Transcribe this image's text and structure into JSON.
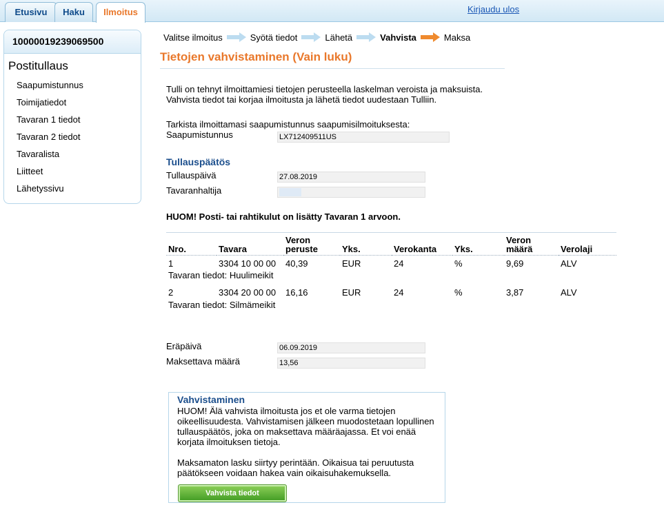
{
  "tabs": [
    {
      "label": "Etusivu"
    },
    {
      "label": "Haku"
    },
    {
      "label": "Ilmoitus"
    }
  ],
  "logout_label": "Kirjaudu ulos",
  "sidebar": {
    "id_number": "10000019239069500",
    "title": "Postitullaus",
    "items": [
      {
        "label": "Saapumistunnus"
      },
      {
        "label": "Toimijatiedot"
      },
      {
        "label": "Tavaran 1 tiedot"
      },
      {
        "label": "Tavaran 2 tiedot"
      },
      {
        "label": "Tavaralista"
      },
      {
        "label": "Liitteet"
      },
      {
        "label": "Lähetyssivu"
      }
    ]
  },
  "steps": [
    {
      "label": "Valitse ilmoitus"
    },
    {
      "label": "Syötä tiedot"
    },
    {
      "label": "Lähetä"
    },
    {
      "label": "Vahvista"
    },
    {
      "label": "Maksa"
    }
  ],
  "page_title": "Tietojen vahvistaminen  (Vain luku)",
  "intro": {
    "line1": "Tulli on tehnyt ilmoittamiesi tietojen perusteella laskelman veroista ja maksuista.",
    "line2": "Vahvista tiedot tai korjaa ilmoitusta ja lähetä tiedot uudestaan Tulliin."
  },
  "check_text": "Tarkista ilmoittamasi saapumistunnus saapumisilmoituksesta:",
  "arrival": {
    "label": "Saapumistunnus",
    "value": "LX712409511US"
  },
  "decision": {
    "title": "Tullauspäätös",
    "date_label": "Tullauspäivä",
    "date_value": "27.08.2019",
    "holder_label": "Tavaranhaltija",
    "holder_value": ""
  },
  "note": "HUOM! Posti- tai rahtikulut on lisätty Tavaran 1 arvoon.",
  "table": {
    "headers": {
      "nro": "Nro.",
      "tavara": "Tavara",
      "peruste_l1": "Veron",
      "peruste_l2": "peruste",
      "yks1": "Yks.",
      "verokanta": "Verokanta",
      "yks2": "Yks.",
      "maara_l1": "Veron",
      "maara_l2": "määrä",
      "verolaji": "Verolaji"
    },
    "rows": [
      {
        "nro": "1",
        "tavara": "3304 10 00 00",
        "peruste": "40,39",
        "yks1": "EUR",
        "verokanta": "24",
        "yks2": "%",
        "maara": "9,69",
        "verolaji": "ALV",
        "info": "Tavaran tiedot: Huulimeikit"
      },
      {
        "nro": "2",
        "tavara": "3304 20 00 00",
        "peruste": "16,16",
        "yks1": "EUR",
        "verokanta": "24",
        "yks2": "%",
        "maara": "3,87",
        "verolaji": "ALV",
        "info": "Tavaran tiedot: Silmämeikit"
      }
    ]
  },
  "due": {
    "label": "Eräpäivä",
    "value": "06.09.2019"
  },
  "amount": {
    "label": "Maksettava määrä",
    "value": "13,56"
  },
  "confirm": {
    "title": "Vahvistaminen",
    "p1_l1": "HUOM! Älä vahvista ilmoitusta jos et ole varma tietojen",
    "p1_l2": "oikeellisuudesta. Vahvistamisen jälkeen muodostetaan lopullinen",
    "p1_l3": "tullauspäätös, joka on maksettava määräajassa. Et voi enää",
    "p1_l4": "korjata ilmoituksen tietoja.",
    "p2_l1": "Maksamaton lasku siirtyy perintään. Oikaisua tai peruutusta",
    "p2_l2": "päätökseen voidaan hakea vain oikaisuhakemuksella.",
    "button": "Vahvista tiedot"
  },
  "colors": {
    "accent_orange": "#e9782b",
    "heading_blue": "#1b4e8c",
    "link_blue": "#1a57b5",
    "button_green": "#3f9a22"
  }
}
